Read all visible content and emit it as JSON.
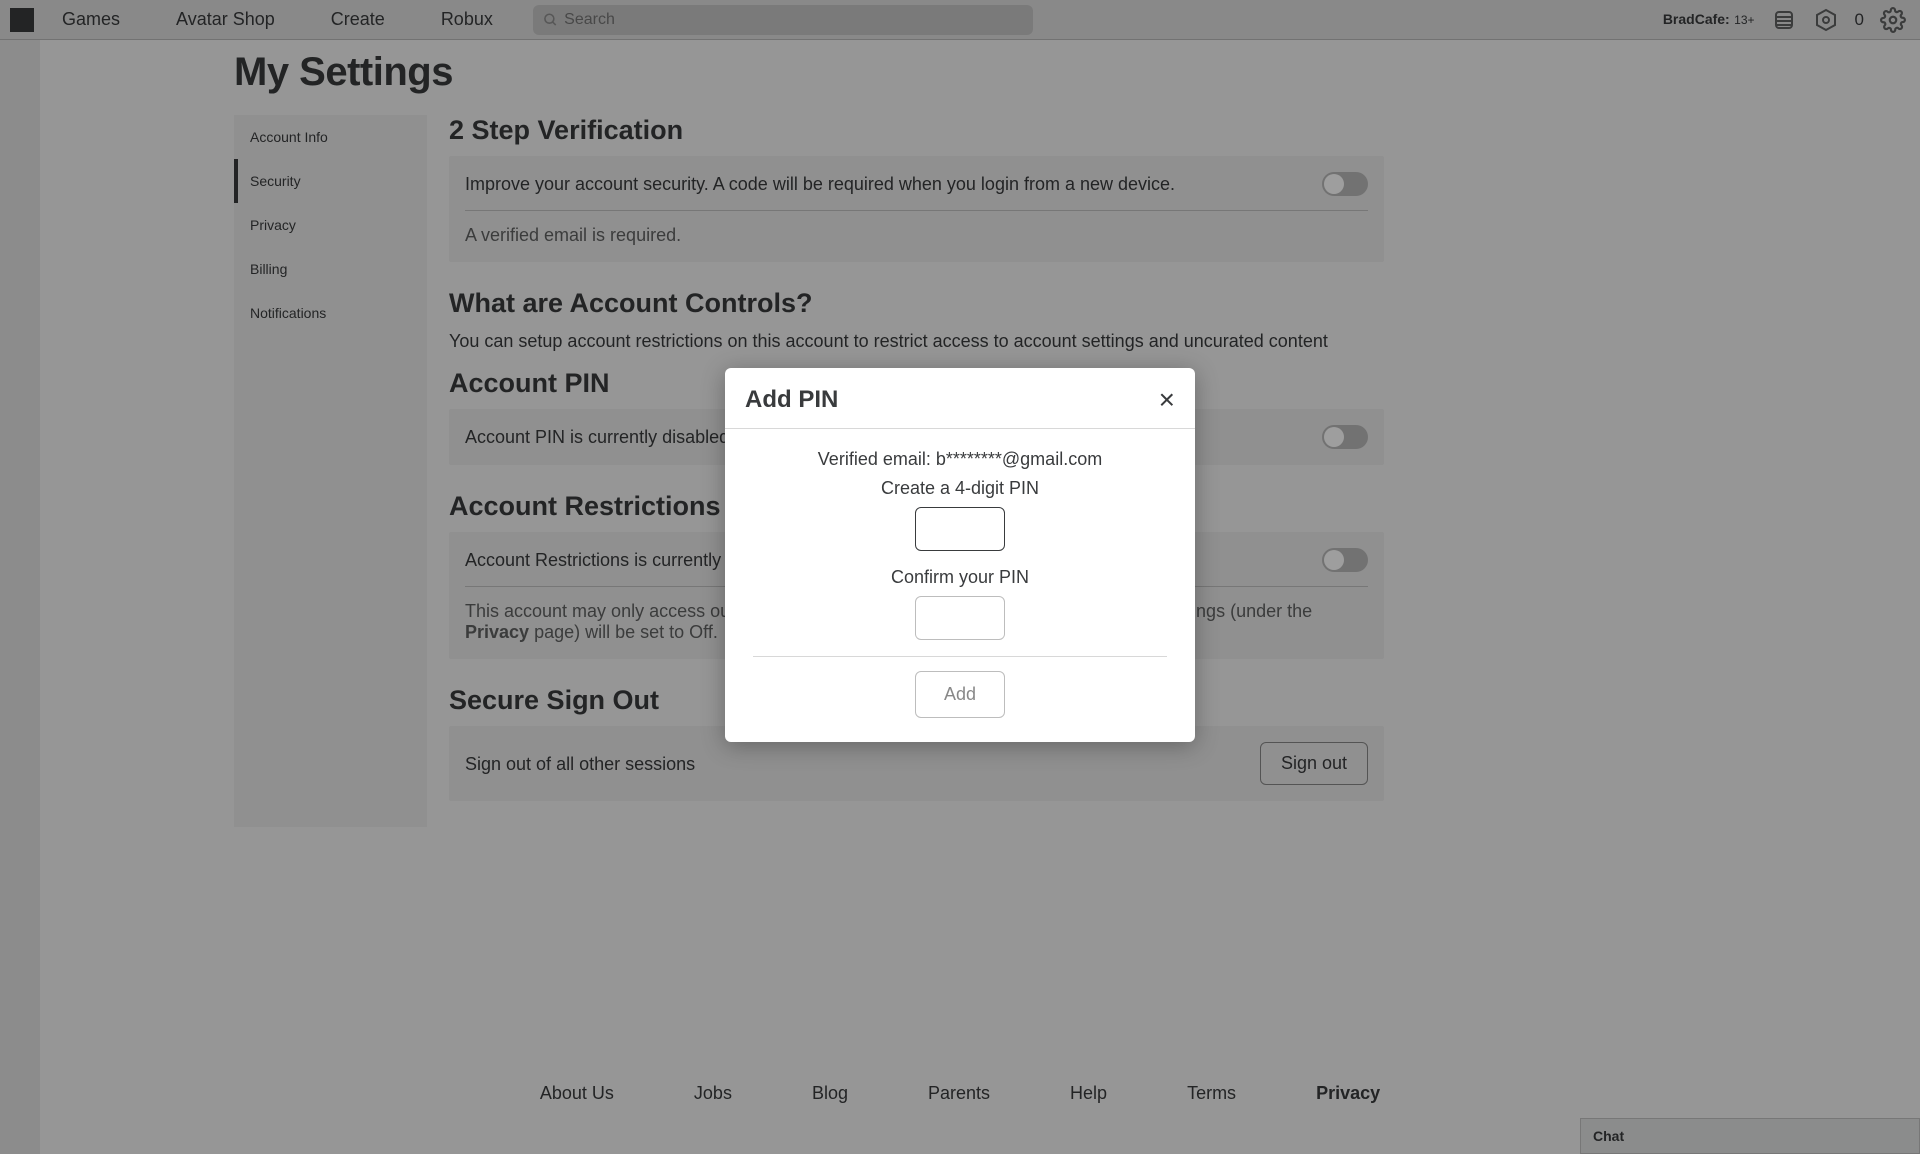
{
  "nav": {
    "links": [
      "Games",
      "Avatar Shop",
      "Create",
      "Robux"
    ],
    "search_placeholder": "Search",
    "username": "BradCafe:",
    "age": "13+",
    "robux": "0"
  },
  "page": {
    "title": "My Settings"
  },
  "sidemenu": {
    "items": [
      "Account Info",
      "Security",
      "Privacy",
      "Billing",
      "Notifications"
    ],
    "active_index": 1
  },
  "sections": {
    "two_step": {
      "title": "2 Step Verification",
      "desc": "Improve your account security. A code will be required when you login from a new device.",
      "note": "A verified email is required."
    },
    "controls": {
      "title": "What are Account Controls?",
      "desc": "You can setup account restrictions on this account to restrict access to account settings and uncurated content"
    },
    "pin": {
      "title": "Account PIN",
      "label": "Account PIN is currently disabled"
    },
    "restrict": {
      "title": "Account Restrictions",
      "label": "Account Restrictions is currently disabled",
      "desc_before": "This account may only access our curated content on the platform. Additionally, contact settings (under the ",
      "privacy_link": "Privacy",
      "desc_after": " page) will be set to Off."
    },
    "signout": {
      "title": "Secure Sign Out",
      "label": "Sign out of all other sessions",
      "button": "Sign out"
    }
  },
  "footer": {
    "links": [
      "About Us",
      "Jobs",
      "Blog",
      "Parents",
      "Help",
      "Terms",
      "Privacy"
    ]
  },
  "chat": {
    "label": "Chat"
  },
  "modal": {
    "title": "Add PIN",
    "verified_email": "Verified email: b********@gmail.com",
    "create_label": "Create a 4-digit PIN",
    "confirm_label": "Confirm your PIN",
    "button": "Add"
  }
}
